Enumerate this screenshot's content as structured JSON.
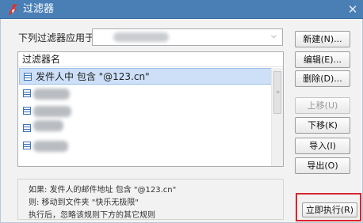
{
  "window": {
    "title": "过滤器",
    "close": "✕",
    "accent_color": "#4a7fb6",
    "highlight_color": "#d8262f"
  },
  "apply": {
    "label": "下列过滤器应用于:",
    "dropdown_arrow": "⌵"
  },
  "list": {
    "header": "过滤器名",
    "rows": [
      {
        "text": "发件人中 包含 \"@123.cn\"",
        "selected": true,
        "icon": "filter-list-icon"
      },
      {
        "text": "",
        "selected": false,
        "icon": "filter-list-icon"
      },
      {
        "text": "",
        "selected": false,
        "icon": "filter-list-icon"
      },
      {
        "text": "",
        "selected": false,
        "icon": "filter-list-icon"
      },
      {
        "text": "",
        "selected": false,
        "icon": "filter-list-icon"
      }
    ],
    "scroll_grip": "≡"
  },
  "description": {
    "lines": [
      "如果: 发件人的邮件地址 包含 \"@123.cn\"",
      "则:  移动到文件夹 \"快乐无极限\"",
      "执行后，忽略该规则下方的其它规则"
    ]
  },
  "buttons": {
    "new": "新建(N)...",
    "edit": "编辑(E)...",
    "delete": "删除(D)...",
    "move_up": "上移(U)",
    "move_down": "下移(K)",
    "import": "导入(I)",
    "export": "导出(O)",
    "run_now": "立即执行(R)"
  }
}
